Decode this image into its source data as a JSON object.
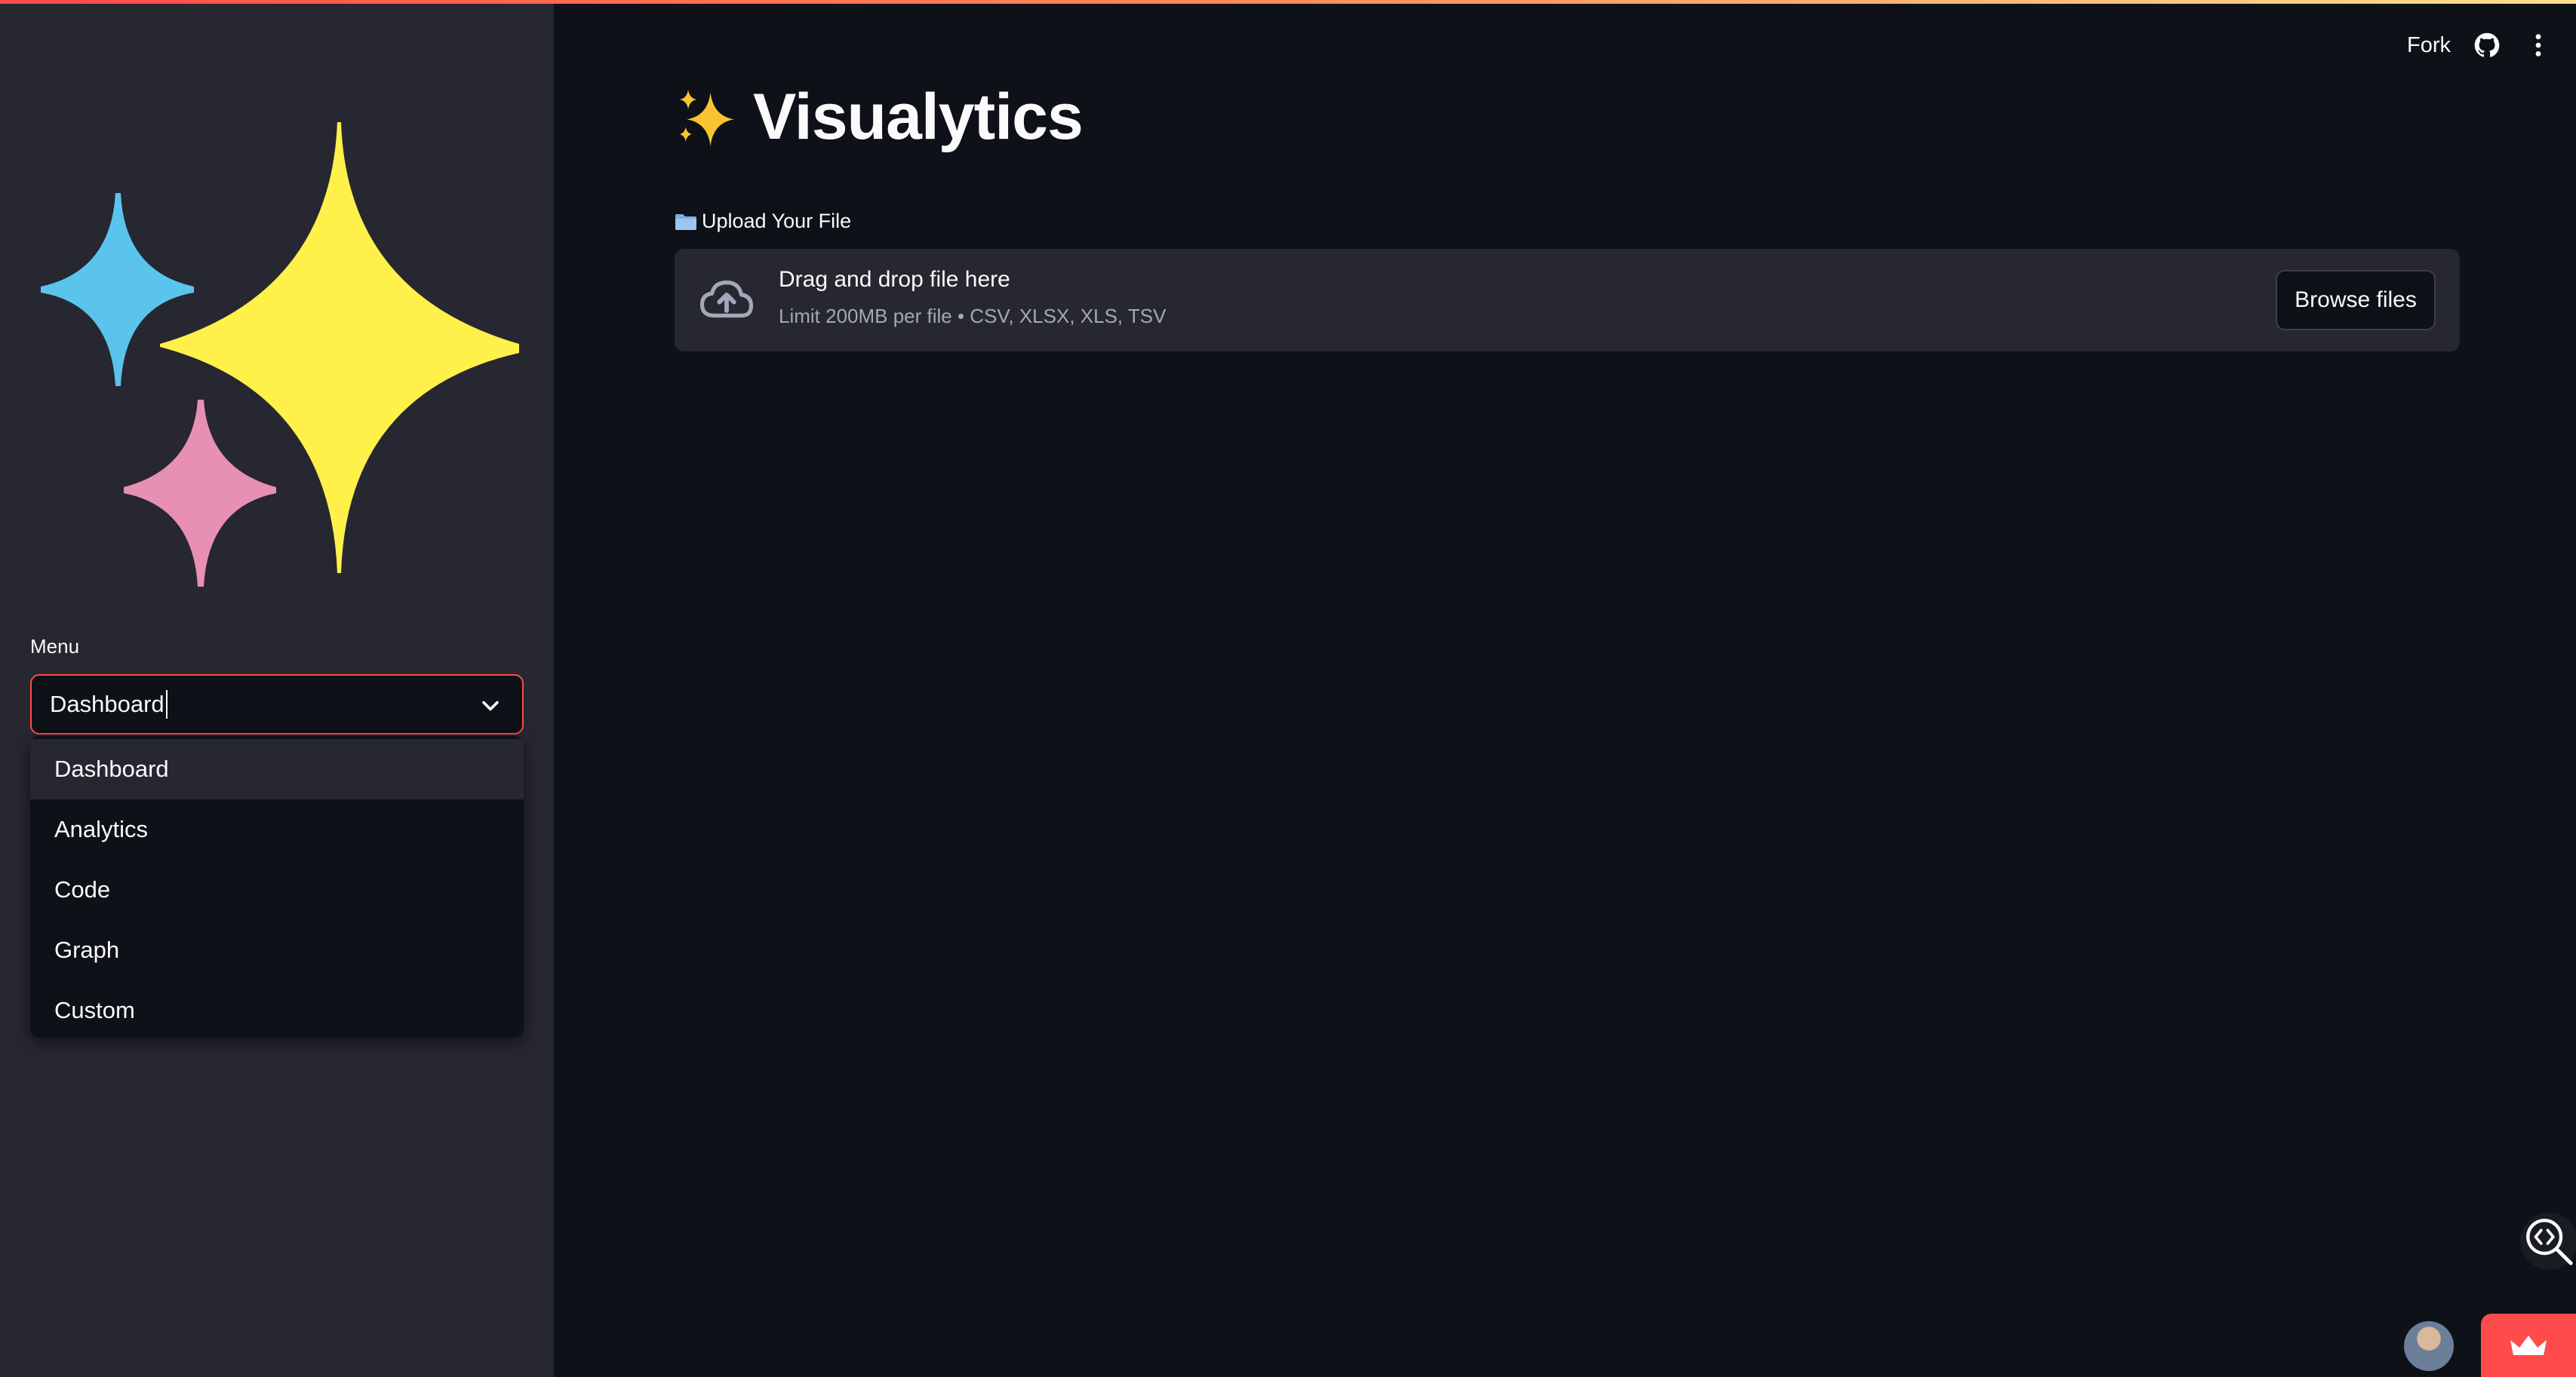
{
  "app": {
    "title_emoji": "✨",
    "title": "Visualytics",
    "accent_color": "#ff4b4b",
    "background": "#0e1117",
    "sidebar_background": "#262730"
  },
  "header": {
    "fork_label": "Fork",
    "github_icon": "github-icon",
    "menu_icon": "kebab-menu-icon"
  },
  "sidebar": {
    "logo": {
      "icon": "sparkles-icon",
      "colors": [
        "#fff04a",
        "#5bc4ec",
        "#e88fb4"
      ]
    },
    "menu_label": "Menu",
    "select": {
      "value": "Dashboard",
      "options": [
        "Dashboard",
        "Analytics",
        "Code",
        "Graph",
        "Custom"
      ],
      "highlighted": "Dashboard"
    }
  },
  "upload": {
    "label_icon": "folder-icon",
    "label": "Upload Your File",
    "dropzone_title": "Drag and drop file here",
    "dropzone_subtitle": "Limit 200MB per file • CSV, XLSX, XLS, TSV",
    "browse_label": "Browse files",
    "icon": "cloud-upload-icon"
  },
  "footer": {
    "inspector_icon": "code-search-icon",
    "avatar_icon": "avatar",
    "badge_icon": "crown-icon"
  }
}
